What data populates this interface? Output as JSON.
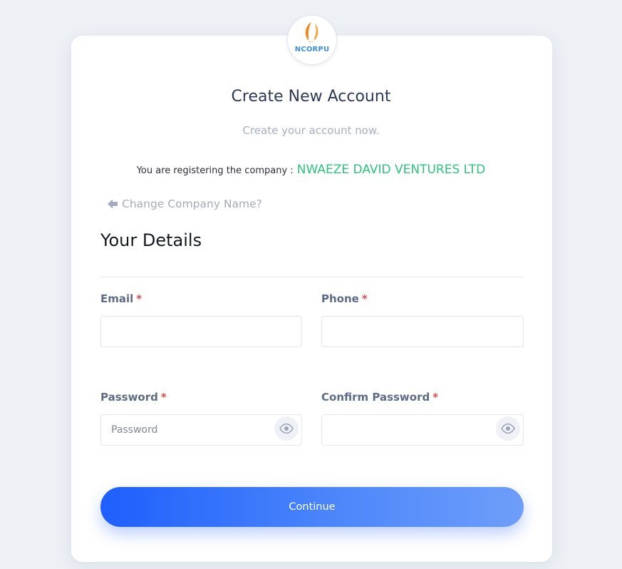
{
  "logo": {
    "text": "NCORPU",
    "icon": "company-logo"
  },
  "header": {
    "title": "Create New Account",
    "subtitle": "Create your account now."
  },
  "company": {
    "prefix": "You are registering the company :",
    "name": "NWAEZE DAVID VENTURES LTD",
    "name_color": "#2ec27e"
  },
  "change_link": {
    "label": "Change Company Name?",
    "icon": "arrow-left-icon"
  },
  "section": {
    "title": "Your Details"
  },
  "form": {
    "required_marker": "*",
    "email": {
      "label": "Email",
      "value": "",
      "placeholder": ""
    },
    "phone": {
      "label": "Phone",
      "value": "",
      "placeholder": ""
    },
    "password": {
      "label": "Password",
      "value": "",
      "placeholder": "Password",
      "toggle_icon": "eye-icon"
    },
    "confirm_password": {
      "label": "Confirm Password",
      "value": "",
      "placeholder": "",
      "toggle_icon": "eye-icon"
    }
  },
  "actions": {
    "continue_label": "Continue",
    "accent": "#1f5ffc"
  }
}
